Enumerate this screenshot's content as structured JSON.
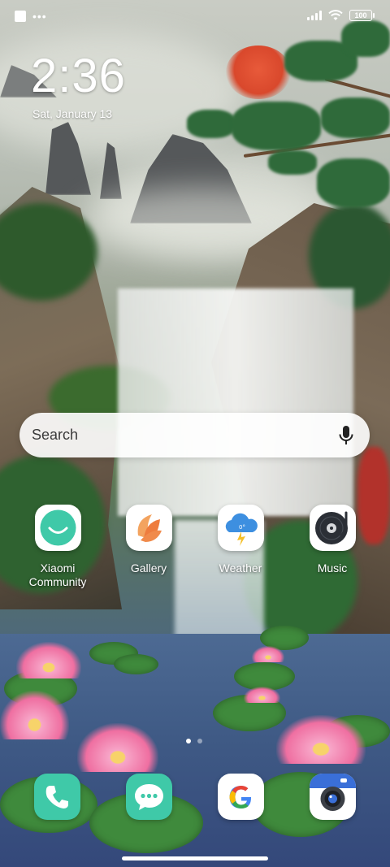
{
  "status_bar": {
    "battery_level": "100",
    "signal_bars": 4
  },
  "clock": {
    "time": "2:36",
    "date": "Sat, January 13"
  },
  "search": {
    "placeholder": "Search"
  },
  "apps": [
    {
      "label_line1": "Xiaomi",
      "label_line2": "Community",
      "icon": "smile-icon"
    },
    {
      "label_line1": "Gallery",
      "label_line2": "",
      "icon": "gallery-petals-icon"
    },
    {
      "label_line1": "Weather",
      "label_line2": "",
      "icon": "cloud-lightning-icon"
    },
    {
      "label_line1": "Music",
      "label_line2": "",
      "icon": "vinyl-record-icon"
    }
  ],
  "weather_temp": "0°",
  "page_indicator": {
    "pages": 2,
    "current": 1
  },
  "dock": [
    {
      "icon": "phone-icon"
    },
    {
      "icon": "messaging-icon"
    },
    {
      "icon": "google-icon",
      "letter": "G"
    },
    {
      "icon": "camera-icon"
    }
  ],
  "colors": {
    "teal_accent": "#3fc9a8",
    "gallery_orange": "#f08a4b",
    "weather_blue": "#3d8fe0",
    "camera_blue": "#3a6fd8"
  }
}
